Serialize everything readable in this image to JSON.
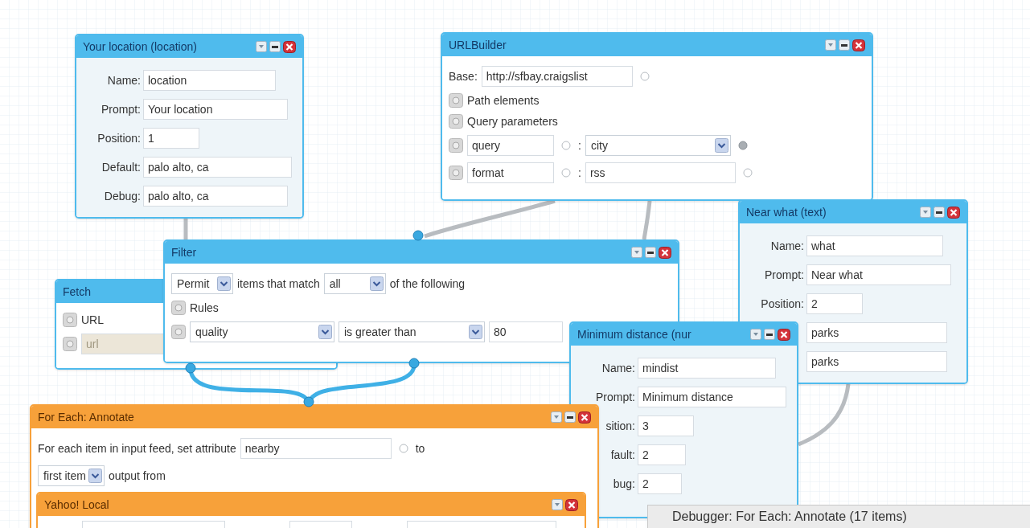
{
  "modules": [
    {
      "kind": "user_input",
      "title": "Your location (location)",
      "color": "#4fbbed",
      "buttons": [
        {
          "kind": "help"
        },
        {
          "kind": "minimize"
        },
        {
          "kind": "close"
        }
      ],
      "rows": [
        {
          "label": "Name:",
          "value": "location"
        },
        {
          "label": "Prompt:",
          "value": "Your location"
        },
        {
          "label": "Position:",
          "value": "1"
        },
        {
          "label": "Default:",
          "value": "palo alto, ca"
        },
        {
          "label": "Debug:",
          "value": "palo alto, ca"
        }
      ]
    },
    {
      "kind": "operator",
      "title": "URLBuilder",
      "color": "#4fbbed",
      "buttons": [
        {
          "kind": "help"
        },
        {
          "kind": "minimize"
        },
        {
          "kind": "close"
        }
      ],
      "rows": [
        {
          "items": [
            {
              "kind": "label",
              "text": "Base:"
            },
            {
              "kind": "field",
              "value": "http://sfbay.craigslist"
            },
            {
              "kind": "terminal",
              "connected": false
            }
          ]
        },
        {
          "items": [
            {
              "kind": "toggle"
            },
            {
              "kind": "text",
              "text": "Path elements"
            }
          ]
        },
        {
          "items": [
            {
              "kind": "toggle"
            },
            {
              "kind": "text",
              "text": "Query parameters"
            }
          ]
        },
        {
          "items": [
            {
              "kind": "toggle"
            },
            {
              "kind": "field",
              "value": "query"
            },
            {
              "kind": "terminal",
              "connected": false
            },
            {
              "kind": "text",
              "text": ":"
            },
            {
              "kind": "select",
              "value": "city"
            },
            {
              "kind": "terminal",
              "connected": true
            }
          ]
        },
        {
          "items": [
            {
              "kind": "toggle"
            },
            {
              "kind": "field",
              "value": "format"
            },
            {
              "kind": "terminal",
              "connected": false
            },
            {
              "kind": "text",
              "text": ":"
            },
            {
              "kind": "field",
              "value": "rss"
            },
            {
              "kind": "terminal",
              "connected": false
            }
          ]
        }
      ]
    },
    {
      "kind": "user_input",
      "title": "Near what (text)",
      "color": "#4fbbed",
      "buttons": [
        {
          "kind": "help"
        },
        {
          "kind": "minimize"
        },
        {
          "kind": "close"
        }
      ],
      "rows": [
        {
          "label": "Name:",
          "value": "what"
        },
        {
          "label": "Prompt:",
          "value": "Near what"
        },
        {
          "label": "Position:",
          "value": "2"
        },
        {
          "value": "parks"
        },
        {
          "value": "parks"
        }
      ]
    },
    {
      "kind": "operator",
      "title": "Fetch",
      "color": "#4fbbed",
      "rows": [
        {
          "items": [
            {
              "kind": "toggle"
            },
            {
              "kind": "text",
              "text": "URL"
            }
          ]
        },
        {
          "items": [
            {
              "kind": "toggle"
            },
            {
              "kind": "field",
              "placeholder": "url",
              "disabled": true
            }
          ]
        }
      ]
    },
    {
      "kind": "operator",
      "title": "Filter",
      "color": "#4fbbed",
      "buttons": [
        {
          "kind": "help"
        },
        {
          "kind": "minimize"
        },
        {
          "kind": "close"
        }
      ],
      "rows": [
        {
          "items": [
            {
              "kind": "select",
              "value": "Permit"
            },
            {
              "kind": "text",
              "text": "items that match"
            },
            {
              "kind": "select",
              "value": "all"
            },
            {
              "kind": "text",
              "text": "of the following"
            }
          ]
        },
        {
          "items": [
            {
              "kind": "toggle"
            },
            {
              "kind": "text",
              "text": "Rules"
            }
          ]
        },
        {
          "items": [
            {
              "kind": "toggle"
            },
            {
              "kind": "select",
              "value": "quality"
            },
            {
              "kind": "select",
              "value": "is greater than"
            },
            {
              "kind": "field",
              "value": "80"
            }
          ]
        }
      ]
    },
    {
      "kind": "user_input",
      "title": "Minimum distance (nur",
      "color": "#4fbbed",
      "buttons": [
        {
          "kind": "help"
        },
        {
          "kind": "minimize"
        },
        {
          "kind": "close"
        }
      ],
      "rows": [
        {
          "label": "Name:",
          "value": "mindist"
        },
        {
          "label": "Prompt:",
          "value": "Minimum distance"
        },
        {
          "label": "sition:",
          "value": "3"
        },
        {
          "label": "fault:",
          "value": "2"
        },
        {
          "label": "bug:",
          "value": "2"
        }
      ]
    },
    {
      "kind": "operator",
      "title": "For Each: Annotate",
      "color": "#f7a13a",
      "buttons": [
        {
          "kind": "help"
        },
        {
          "kind": "minimize"
        },
        {
          "kind": "close"
        }
      ],
      "rows": [
        {
          "items": [
            {
              "kind": "text",
              "text": "For each item in input feed, set attribute"
            },
            {
              "kind": "field",
              "value": "nearby"
            },
            {
              "kind": "terminal",
              "connected": false
            },
            {
              "kind": "text",
              "text": "to"
            }
          ]
        },
        {
          "items": [
            {
              "kind": "select",
              "value": "first item"
            },
            {
              "kind": "text",
              "text": "output from"
            }
          ]
        }
      ],
      "submodule": {
        "title": "Yahoo! Local",
        "color": "#f7a13a",
        "buttons": [
          {
            "kind": "help"
          },
          {
            "kind": "close"
          }
        ],
        "rows": [
          {
            "items": [
              {
                "kind": "field"
              },
              {
                "kind": "field"
              },
              {
                "kind": "field"
              }
            ]
          }
        ]
      }
    }
  ],
  "debugger": {
    "text": "Debugger: For Each: Annotate (17 items)"
  }
}
